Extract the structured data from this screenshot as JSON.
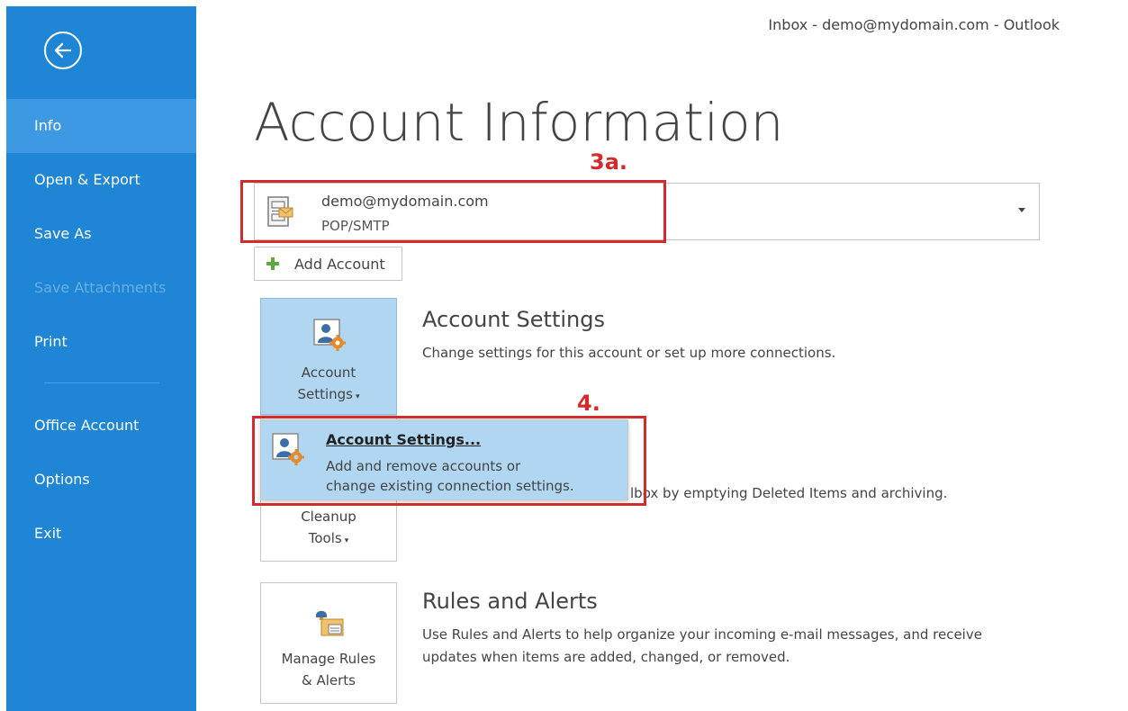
{
  "window": {
    "title": "Inbox - demo@mydomain.com - Outlook"
  },
  "sidebar": {
    "back_icon": "back-arrow-circle-icon",
    "items": [
      {
        "label": "Info",
        "active": true,
        "disabled": false
      },
      {
        "label": "Open & Export",
        "active": false,
        "disabled": false
      },
      {
        "label": "Save As",
        "active": false,
        "disabled": false
      },
      {
        "label": "Save Attachments",
        "active": false,
        "disabled": true
      },
      {
        "label": "Print",
        "active": false,
        "disabled": false
      },
      {
        "label": "Office Account",
        "active": false,
        "disabled": false
      },
      {
        "label": "Options",
        "active": false,
        "disabled": false
      },
      {
        "label": "Exit",
        "active": false,
        "disabled": false
      }
    ],
    "colors": {
      "background": "#1e86d5",
      "active": "#3d9ae2"
    }
  },
  "page": {
    "title": "Account Information"
  },
  "annotations": {
    "step_3a": "3a.",
    "step_4": "4.",
    "color": "#d22b2b"
  },
  "account_selector": {
    "email": "demo@mydomain.com",
    "type": "POP/SMTP",
    "icon": "email-account-icon"
  },
  "add_account": {
    "label": "Add Account",
    "icon": "plus-icon"
  },
  "sections": {
    "account_settings": {
      "tile_label_line1": "Account",
      "tile_label_line2": "Settings",
      "tile_icon": "account-settings-icon",
      "title": "Account Settings",
      "description": "Change settings for this account or set up more connections.",
      "active": true
    },
    "cleanup_tools": {
      "tile_label_line1": "Cleanup",
      "tile_label_line2": "Tools",
      "description_fragment": "lbox by emptying Deleted Items and archiving."
    },
    "rules_alerts": {
      "tile_label_line1": "Manage Rules",
      "tile_label_line2": "& Alerts",
      "tile_icon": "rules-alerts-icon",
      "title": "Rules and Alerts",
      "description_line1": "Use Rules and Alerts to help organize your incoming e-mail messages, and receive",
      "description_line2": "updates when items are added, changed, or removed."
    }
  },
  "dropdown_menu": {
    "item": {
      "title": "Account Settings...",
      "description_line1": "Add and remove accounts or",
      "description_line2": "change existing connection settings.",
      "icon": "account-settings-icon",
      "highlighted": true
    },
    "colors": {
      "highlight": "#b1d6f2"
    }
  }
}
